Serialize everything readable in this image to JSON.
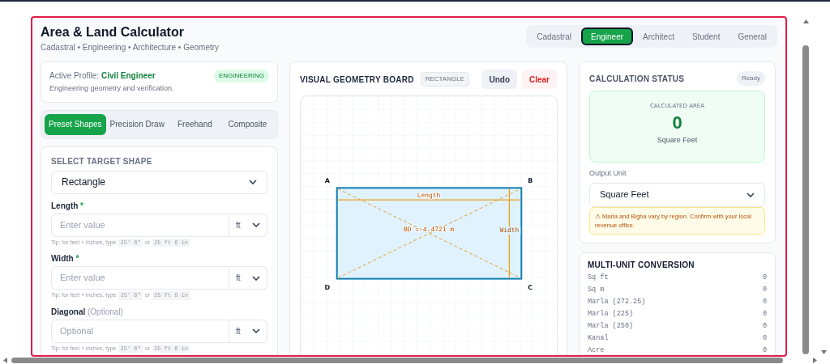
{
  "header": {
    "title": "Area & Land Calculator",
    "subtitle": "Cadastral • Engineering • Architecture • Geometry"
  },
  "profile_tabs": [
    {
      "label": "Cadastral",
      "selected": false
    },
    {
      "label": "Engineer",
      "selected": true
    },
    {
      "label": "Architect",
      "selected": false
    },
    {
      "label": "Student",
      "selected": false
    },
    {
      "label": "General",
      "selected": false
    }
  ],
  "profile": {
    "label": "Active Profile:",
    "name": "Civil Engineer",
    "badge": "ENGINEERING",
    "description": "Engineering geometry and verification."
  },
  "mode_tabs": [
    {
      "label": "Preset Shapes",
      "selected": true
    },
    {
      "label": "Precision Draw",
      "selected": false
    },
    {
      "label": "Freehand",
      "selected": false
    },
    {
      "label": "Composite",
      "selected": false
    }
  ],
  "shape_form": {
    "heading": "SELECT TARGET SHAPE",
    "shape": "Rectangle",
    "fields": [
      {
        "label": "Length",
        "marker": "*",
        "placeholder": "Enter value",
        "unit": "ft",
        "tip": "Tip: for feet + inches, type",
        "code_1": "25' 6\"",
        "or": "or",
        "code_2": "25 ft 6 in"
      },
      {
        "label": "Width",
        "marker": "*",
        "placeholder": "Enter value",
        "unit": "ft",
        "tip": "Tip: for feet + inches, type",
        "code_1": "25' 6\"",
        "or": "or",
        "code_2": "25 ft 6 in"
      },
      {
        "label": "Diagonal",
        "note": "(Optional)",
        "placeholder": "Optional",
        "unit": "ft",
        "tip": "Tip: for feet + inches, type",
        "code_1": "25' 6\"",
        "or": "or",
        "code_2": "25 ft 6 in"
      }
    ]
  },
  "board": {
    "title": "VISUAL GEOMETRY BOARD",
    "badge": "RECTANGLE",
    "buttons": [
      {
        "label": "Undo",
        "kind": "neutral"
      },
      {
        "label": "Clear",
        "kind": "danger"
      }
    ],
    "drawing": {
      "vertices": [
        "A",
        "B",
        "D",
        "C"
      ],
      "length_label": "Length",
      "width_label": "Width",
      "diagonal_label": "BD = 4.4721 m"
    }
  },
  "status": {
    "title": "CALCULATION STATUS",
    "badge": "Ready",
    "area_label": "CALCULATED AREA",
    "area_value": "0",
    "area_unit": "Square Feet",
    "output_label": "Output Unit",
    "output_value": "Square Feet",
    "warning": "⚠ Marla and Bigha vary by region. Confirm with your local revenue office."
  },
  "conversion": {
    "title": "MULTI-UNIT CONVERSION",
    "rows": [
      {
        "unit": "Sq ft",
        "value": "0"
      },
      {
        "unit": "Sq m",
        "value": "0"
      },
      {
        "unit": "Marla (272.25)",
        "value": "0"
      },
      {
        "unit": "Marla (225)",
        "value": "0"
      },
      {
        "unit": "Marla (250)",
        "value": "0"
      },
      {
        "unit": "Kanal",
        "value": "0"
      },
      {
        "unit": "Acre",
        "value": "0"
      }
    ]
  }
}
